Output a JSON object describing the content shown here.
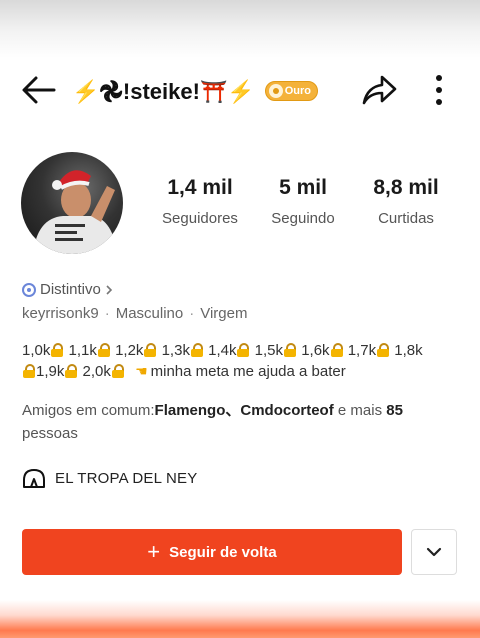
{
  "header": {
    "title_text": "⚡𖣘!steike!⛩️⚡",
    "badge_label": "Ouro"
  },
  "stats": [
    {
      "value": "1,4 mil",
      "label": "Seguidores"
    },
    {
      "value": "5 mil",
      "label": "Seguindo"
    },
    {
      "value": "8,8 mil",
      "label": "Curtidas"
    }
  ],
  "profile": {
    "distintivo": "Distintivo",
    "username": "keyrrisonk9",
    "gender": "Masculino",
    "sign": "Virgem"
  },
  "bio": {
    "milestones": [
      "1,0k",
      "1,1k",
      "1,2k",
      "1,3k",
      "1,4k",
      "1,5k",
      "1,6k",
      "1,7k",
      "1,8k",
      "1,9k",
      "2,0k"
    ],
    "text": "minha meta me ajuda a bater"
  },
  "friends": {
    "prefix": "Amigos em comum:",
    "names": "Flamengo、Cmdocorteof",
    "middle": " e mais ",
    "count": "85",
    "suffix": "pessoas"
  },
  "group": {
    "name": "EL TROPA DEL NEY"
  },
  "actions": {
    "follow_label": "Seguir de volta"
  },
  "colors": {
    "accent": "#f0441f",
    "badge": "#f4b23a",
    "distintivo_icon": "#6b86d9"
  }
}
